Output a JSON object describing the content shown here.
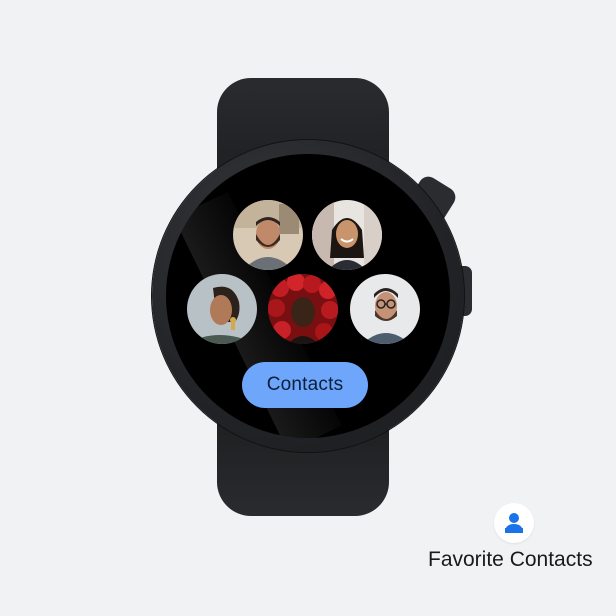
{
  "watch": {
    "button_label": "Contacts",
    "contacts": [
      {
        "avatar": "man-beard-avatar"
      },
      {
        "avatar": "woman-smiling-avatar"
      },
      {
        "avatar": "woman-profile-avatar"
      },
      {
        "avatar": "woman-red-roses-avatar"
      },
      {
        "avatar": "man-glasses-avatar"
      }
    ]
  },
  "tile": {
    "icon": "person-icon",
    "title": "Favorite Contacts"
  },
  "colors": {
    "background": "#f1f2f4",
    "button": "#6da6fb",
    "icon_blue": "#1a73e8"
  }
}
